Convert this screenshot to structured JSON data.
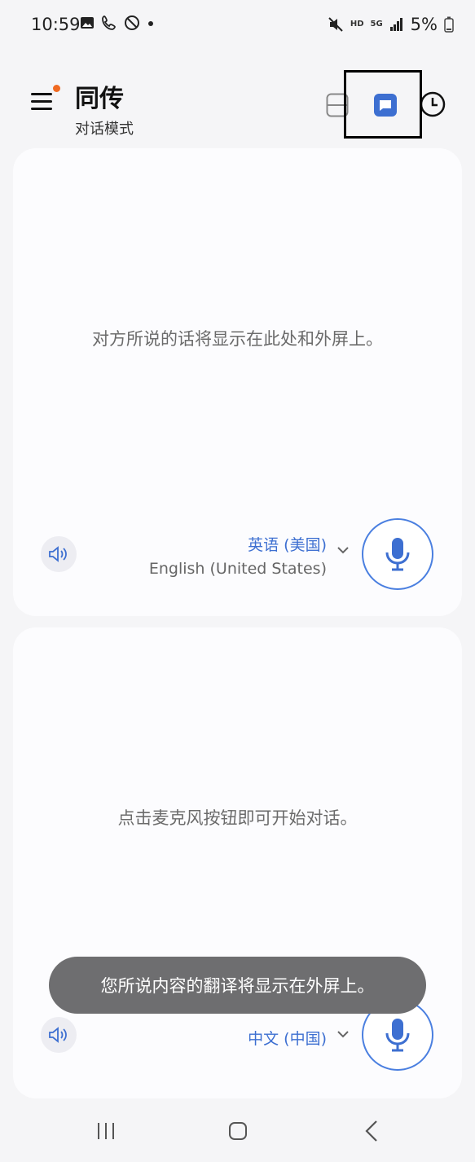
{
  "status_bar": {
    "time": "10:59",
    "hd_label": "HD",
    "network_label": "5G",
    "battery": "5%"
  },
  "header": {
    "title": "同传",
    "subtitle": "对话模式"
  },
  "top_panel": {
    "hint": "对方所说的话将显示在此处和外屏上。",
    "language_name": "英语 (美国)",
    "language_sub": "English (United States)"
  },
  "bottom_panel": {
    "hint": "点击麦克风按钮即可开始对话。",
    "language_name": "中文 (中国)"
  },
  "toast": {
    "message": "您所说内容的翻译将显示在外屏上。"
  },
  "colors": {
    "accent": "#3d6fd1",
    "notification_dot": "#f06a22",
    "toast_bg": "#6e6e70"
  },
  "icons": [
    "menu-icon",
    "split-screen-icon",
    "chat-bubble-icon",
    "history-icon",
    "speaker-icon",
    "microphone-icon",
    "chevron-down-icon"
  ]
}
